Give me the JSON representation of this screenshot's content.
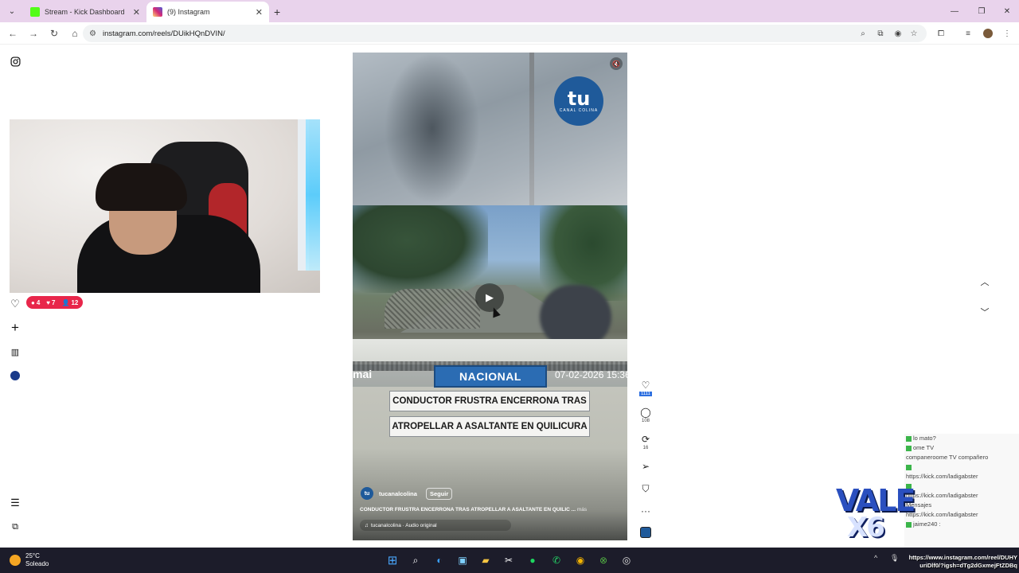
{
  "browser": {
    "tabs": [
      {
        "title": "Stream - Kick Dashboard",
        "favicon_color": "#53fc18",
        "active": false
      },
      {
        "title": "(9) Instagram",
        "favicon_color": "#d6249f",
        "active": true
      }
    ],
    "url": "instagram.com/reels/DUikHQnDVIN/"
  },
  "stream_stats": {
    "chat": "4",
    "likes": "7",
    "viewers": "12"
  },
  "reel": {
    "logo_big": "tu",
    "logo_small": "CANAL COLINA",
    "ticker_left": "mai",
    "category": "NACIONAL",
    "datetime": "07-02-2026 15:36",
    "headline_1": "CONDUCTOR FRUSTRA ENCERRONA TRAS",
    "headline_2": "ATROPELLAR A ASALTANTE EN QUILICURA",
    "author": "tucanalcolina",
    "follow_label": "Seguir",
    "caption": "CONDUCTOR FRUSTRA ENCERRONA TRAS ATROPELLAR A ASALTANTE EN QUILIC ...",
    "caption_more": "más",
    "audio": "tucanalcolina · Audio original"
  },
  "actions": {
    "likes": "1111",
    "comments": "108",
    "reposts": "16"
  },
  "chat_overlay": {
    "lines": [
      {
        "user": "",
        "text": "lo mato?"
      },
      {
        "user": "",
        "text": "ome TV"
      },
      {
        "user": "",
        "text": "companeroome TV compañero"
      },
      {
        "user": "",
        "text": ""
      },
      {
        "user": "",
        "text": "https://kick.com/ladigabster"
      },
      {
        "user": "",
        "text": ""
      },
      {
        "user": "",
        "text": "https://kick.com/ladigabster"
      },
      {
        "user": "",
        "text": "Mensajes"
      },
      {
        "user": "",
        "text": "https://kick.com/ladigabster"
      },
      {
        "user": "",
        "text": "jaime240 :"
      }
    ]
  },
  "overlay_brand": {
    "line1": "VALE",
    "line2": "X6"
  },
  "taskbar": {
    "temperature": "25°C",
    "condition": "Soleado",
    "share_url_1": "https://www.instagram.com/reel/DUHY",
    "share_url_2": "uriDlf0/?igsh=dTg2dGxmejFtZDBq"
  }
}
